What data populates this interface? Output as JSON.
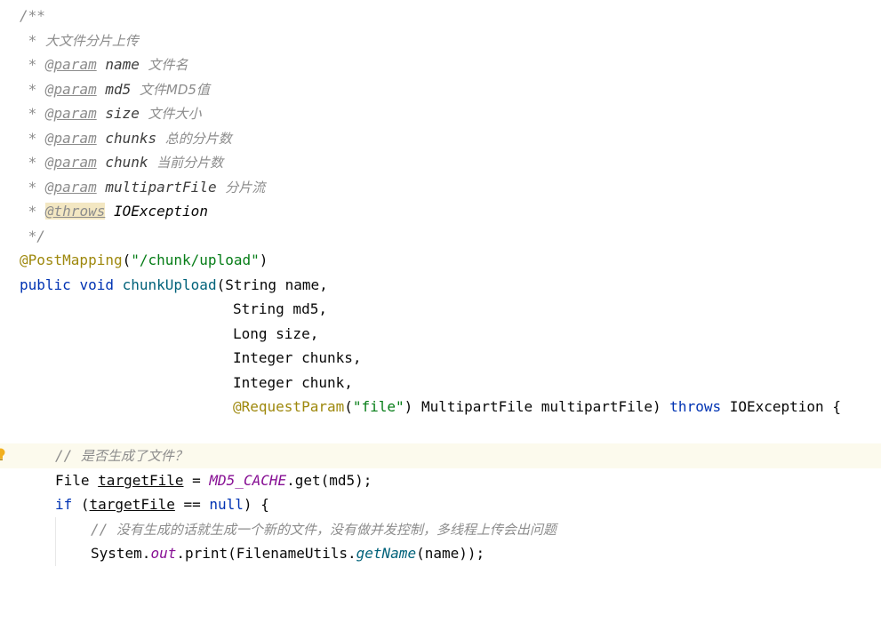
{
  "lines": {
    "l1": {
      "open": "/**"
    },
    "l2": {
      "star": " * ",
      "text": "大文件分片上传"
    },
    "l3": {
      "star": " * ",
      "tag": "@param",
      "name": "name",
      "desc": "文件名"
    },
    "l4": {
      "star": " * ",
      "tag": "@param",
      "name": "md5",
      "desc": "文件MD5值"
    },
    "l5": {
      "star": " * ",
      "tag": "@param",
      "name": "size",
      "desc": "文件大小"
    },
    "l6": {
      "star": " * ",
      "tag": "@param",
      "name": "chunks",
      "desc": "总的分片数"
    },
    "l7": {
      "star": " * ",
      "tag": "@param",
      "name": "chunk",
      "desc": "当前分片数"
    },
    "l8": {
      "star": " * ",
      "tag": "@param",
      "name": "multipartFile",
      "desc": "分片流"
    },
    "l9": {
      "star": " * ",
      "tag": "@throws",
      "name": "IOException"
    },
    "l10": {
      "close": " */"
    },
    "l11": {
      "anno": "@PostMapping",
      "open": "(",
      "str": "\"/chunk/upload\"",
      "close": ")"
    },
    "l12": {
      "kw1": "public",
      "kw2": "void",
      "method": "chunkUpload",
      "rest": "(String name,"
    },
    "l13": {
      "text": "String md5,"
    },
    "l14": {
      "text": "Long size,"
    },
    "l15": {
      "text": "Integer chunks,"
    },
    "l16": {
      "text": "Integer chunk,"
    },
    "l17": {
      "anno": "@RequestParam",
      "open": "(",
      "str": "\"file\"",
      "mid": ") MultipartFile multipartFile) ",
      "kw": "throws",
      "rest": " IOException {"
    },
    "l19": {
      "slashes": "// ",
      "text": "是否生成了文件？"
    },
    "l20": {
      "type": "File ",
      "var": "targetFile",
      "eq": " = ",
      "field": "MD5_CACHE",
      "rest": ".get(md5);"
    },
    "l21": {
      "kw": "if",
      "open": " (",
      "var": "targetFile",
      "eq": " == ",
      "kwnull": "null",
      "rest": ") {"
    },
    "l22": {
      "slashes": "// ",
      "text": "没有生成的话就生成一个新的文件，没有做并发控制，多线程上传会出问题"
    },
    "l23": {
      "cls": "System.",
      "field": "out",
      "mid": ".print(FilenameUtils.",
      "method": "getName",
      "rest": "(name));"
    }
  }
}
